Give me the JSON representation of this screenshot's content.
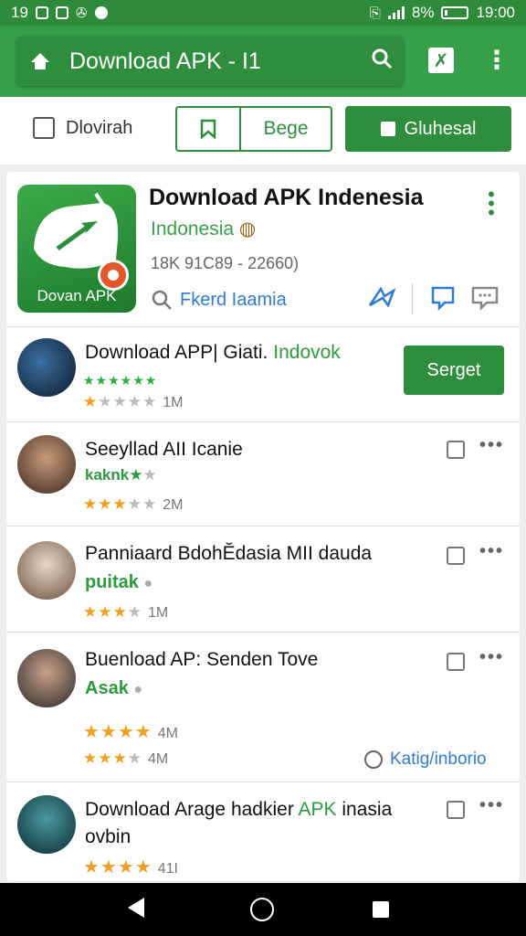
{
  "status_bar": {
    "left_time": "19",
    "battery_percent": "8%",
    "time": "19:00"
  },
  "app_bar": {
    "search_title": "Download APK - I1"
  },
  "filters": {
    "downloads_label": "Dlovirah",
    "pair_label": "Bege",
    "button_label": "Gluhesal"
  },
  "hero": {
    "icon_label": "Dovan APK",
    "name": "Download APK Indenesia",
    "subtitle": "Indonesia",
    "meta": "18K 91C89 - 22660)",
    "find_label": "Fkerd Iaamia"
  },
  "list": [
    {
      "title": "Download APP| Giati.",
      "title_accent": "Indovok",
      "stars_top": "★★★★★★",
      "rating_filled": "★",
      "rating_empty": "★★★★",
      "count": "1M",
      "button": "Serget"
    },
    {
      "title": "Seeyllad AII  Icanie",
      "sub": "kaknk★",
      "sub_empty": "★",
      "rating_filled": "★★★",
      "rating_empty": "★★",
      "count": "2M"
    },
    {
      "title": "Panniaard BdohĔdasia MII dauda",
      "sub": "puitak",
      "rating_filled": "★★★",
      "rating_empty": "★",
      "count": "1M"
    },
    {
      "title": "Buenload AP: Senden Tove",
      "sub": "Asak",
      "rating_a_filled": "★★★★",
      "count_a": "4M",
      "rating_filled": "★★★",
      "rating_empty": "★",
      "count": "4M",
      "link": "Katig/inborio"
    },
    {
      "title": "Download Arage hadkier",
      "title_accent": "APK",
      "title_tail": "inasia",
      "title_line2": "ovbin",
      "rating_filled": "★★★★",
      "count": "41I"
    }
  ],
  "colors": {
    "brand_green": "#36a048",
    "dark_green": "#2e8e3e",
    "link_blue": "#2e7bd8",
    "star_orange": "#f0a020"
  }
}
